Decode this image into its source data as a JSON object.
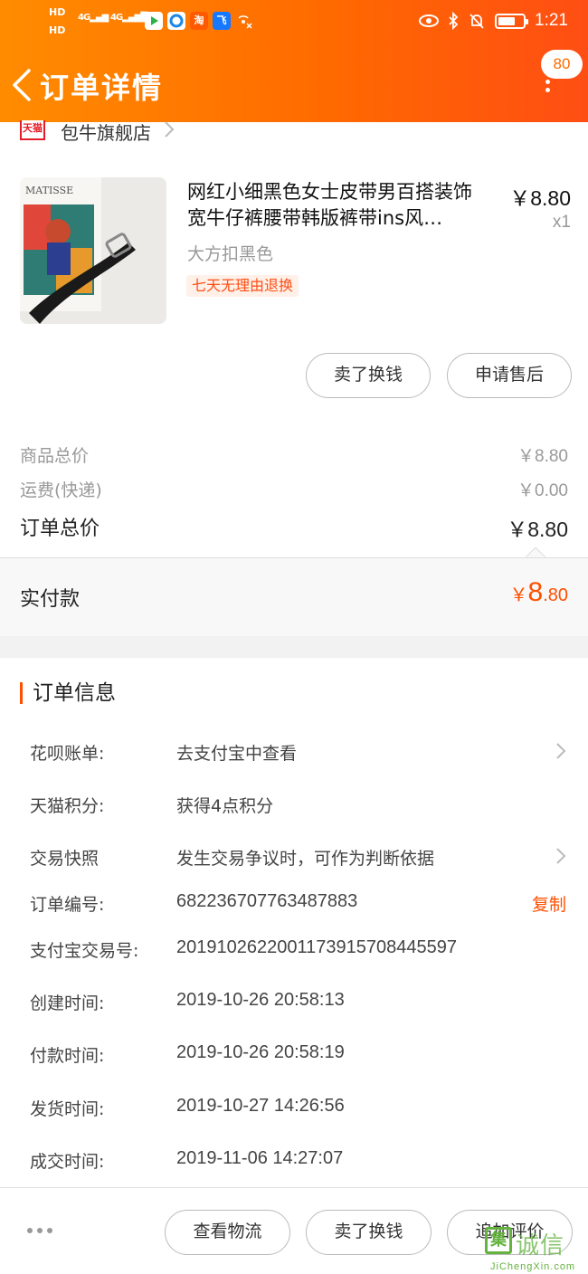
{
  "status_bar": {
    "hd1": "HD",
    "hd2": "HD",
    "net1": "4G",
    "net2": "4G",
    "time": "1:21"
  },
  "header": {
    "title": "订单详情",
    "badge_count": "80"
  },
  "shop": {
    "tag": "天猫",
    "name": "包牛旗舰店"
  },
  "product": {
    "thumb_text": "MATISSE",
    "title": "网红小细黑色女士皮带男百搭装饰宽牛仔裤腰带韩版裤带ins风…",
    "price": "￥8.80",
    "quantity": "x1",
    "sku": "大方扣黑色",
    "promo": "七天无理由退换"
  },
  "item_actions": {
    "sell": "卖了换钱",
    "after_sale": "申请售后"
  },
  "summary": {
    "goods_label": "商品总价",
    "goods_value": "￥8.80",
    "shipping_label": "运费(快递)",
    "shipping_value": "￥0.00",
    "total_label": "订单总价",
    "total_value": "￥8.80",
    "paid_label": "实付款",
    "paid_currency": "￥",
    "paid_int": "8",
    "paid_dec": ".80"
  },
  "order_info": {
    "title": "订单信息",
    "rows": [
      {
        "key": "花呗账单:",
        "value": "去支付宝中查看"
      },
      {
        "key": "天猫积分:",
        "value": "获得4点积分"
      },
      {
        "key": "交易快照",
        "value": "发生交易争议时，可作为判断依据"
      },
      {
        "key": "订单编号:",
        "value": "682236707763487883",
        "action": "复制"
      },
      {
        "key": "支付宝交易号:",
        "value": "2019102622001173915708445597"
      },
      {
        "key": "创建时间:",
        "value": "2019-10-26 20:58:13"
      },
      {
        "key": "付款时间:",
        "value": "2019-10-26 20:58:19"
      },
      {
        "key": "发货时间:",
        "value": "2019-10-27 14:26:56"
      },
      {
        "key": "成交时间:",
        "value": "2019-11-06 14:27:07"
      }
    ]
  },
  "bottom_bar": {
    "logistics": "查看物流",
    "sell": "卖了换钱",
    "review": "追加评价"
  },
  "watermark": {
    "mark": "集",
    "text": "诚信",
    "url": "JiChengXin.com"
  },
  "colors": {
    "accent": "#ff5000",
    "header_start": "#ff8c00",
    "header_end": "#ff4e14",
    "tmall_red": "#e31c27"
  }
}
